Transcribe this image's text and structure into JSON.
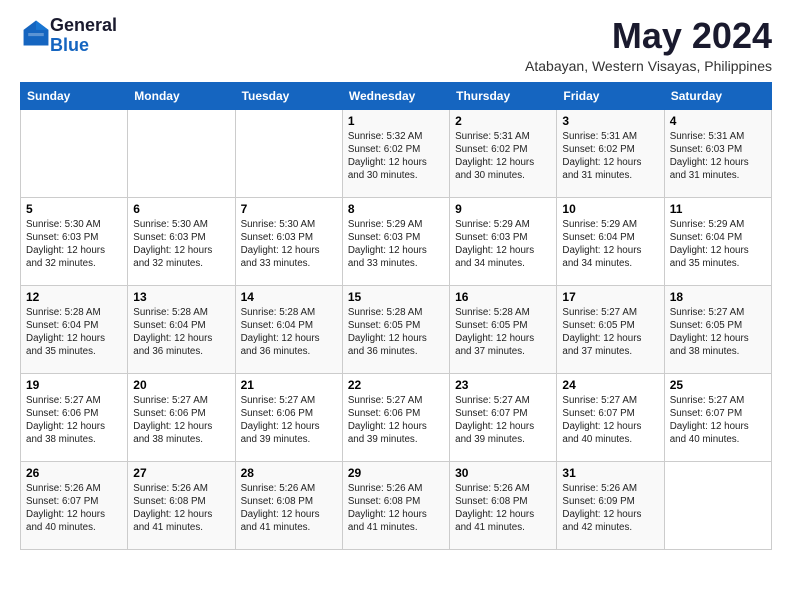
{
  "header": {
    "logo_general": "General",
    "logo_blue": "Blue",
    "month_year": "May 2024",
    "location": "Atabayan, Western Visayas, Philippines"
  },
  "weekdays": [
    "Sunday",
    "Monday",
    "Tuesday",
    "Wednesday",
    "Thursday",
    "Friday",
    "Saturday"
  ],
  "weeks": [
    [
      {
        "day": "",
        "info": ""
      },
      {
        "day": "",
        "info": ""
      },
      {
        "day": "",
        "info": ""
      },
      {
        "day": "1",
        "info": "Sunrise: 5:32 AM\nSunset: 6:02 PM\nDaylight: 12 hours and 30 minutes."
      },
      {
        "day": "2",
        "info": "Sunrise: 5:31 AM\nSunset: 6:02 PM\nDaylight: 12 hours and 30 minutes."
      },
      {
        "day": "3",
        "info": "Sunrise: 5:31 AM\nSunset: 6:02 PM\nDaylight: 12 hours and 31 minutes."
      },
      {
        "day": "4",
        "info": "Sunrise: 5:31 AM\nSunset: 6:03 PM\nDaylight: 12 hours and 31 minutes."
      }
    ],
    [
      {
        "day": "5",
        "info": "Sunrise: 5:30 AM\nSunset: 6:03 PM\nDaylight: 12 hours and 32 minutes."
      },
      {
        "day": "6",
        "info": "Sunrise: 5:30 AM\nSunset: 6:03 PM\nDaylight: 12 hours and 32 minutes."
      },
      {
        "day": "7",
        "info": "Sunrise: 5:30 AM\nSunset: 6:03 PM\nDaylight: 12 hours and 33 minutes."
      },
      {
        "day": "8",
        "info": "Sunrise: 5:29 AM\nSunset: 6:03 PM\nDaylight: 12 hours and 33 minutes."
      },
      {
        "day": "9",
        "info": "Sunrise: 5:29 AM\nSunset: 6:03 PM\nDaylight: 12 hours and 34 minutes."
      },
      {
        "day": "10",
        "info": "Sunrise: 5:29 AM\nSunset: 6:04 PM\nDaylight: 12 hours and 34 minutes."
      },
      {
        "day": "11",
        "info": "Sunrise: 5:29 AM\nSunset: 6:04 PM\nDaylight: 12 hours and 35 minutes."
      }
    ],
    [
      {
        "day": "12",
        "info": "Sunrise: 5:28 AM\nSunset: 6:04 PM\nDaylight: 12 hours and 35 minutes."
      },
      {
        "day": "13",
        "info": "Sunrise: 5:28 AM\nSunset: 6:04 PM\nDaylight: 12 hours and 36 minutes."
      },
      {
        "day": "14",
        "info": "Sunrise: 5:28 AM\nSunset: 6:04 PM\nDaylight: 12 hours and 36 minutes."
      },
      {
        "day": "15",
        "info": "Sunrise: 5:28 AM\nSunset: 6:05 PM\nDaylight: 12 hours and 36 minutes."
      },
      {
        "day": "16",
        "info": "Sunrise: 5:28 AM\nSunset: 6:05 PM\nDaylight: 12 hours and 37 minutes."
      },
      {
        "day": "17",
        "info": "Sunrise: 5:27 AM\nSunset: 6:05 PM\nDaylight: 12 hours and 37 minutes."
      },
      {
        "day": "18",
        "info": "Sunrise: 5:27 AM\nSunset: 6:05 PM\nDaylight: 12 hours and 38 minutes."
      }
    ],
    [
      {
        "day": "19",
        "info": "Sunrise: 5:27 AM\nSunset: 6:06 PM\nDaylight: 12 hours and 38 minutes."
      },
      {
        "day": "20",
        "info": "Sunrise: 5:27 AM\nSunset: 6:06 PM\nDaylight: 12 hours and 38 minutes."
      },
      {
        "day": "21",
        "info": "Sunrise: 5:27 AM\nSunset: 6:06 PM\nDaylight: 12 hours and 39 minutes."
      },
      {
        "day": "22",
        "info": "Sunrise: 5:27 AM\nSunset: 6:06 PM\nDaylight: 12 hours and 39 minutes."
      },
      {
        "day": "23",
        "info": "Sunrise: 5:27 AM\nSunset: 6:07 PM\nDaylight: 12 hours and 39 minutes."
      },
      {
        "day": "24",
        "info": "Sunrise: 5:27 AM\nSunset: 6:07 PM\nDaylight: 12 hours and 40 minutes."
      },
      {
        "day": "25",
        "info": "Sunrise: 5:27 AM\nSunset: 6:07 PM\nDaylight: 12 hours and 40 minutes."
      }
    ],
    [
      {
        "day": "26",
        "info": "Sunrise: 5:26 AM\nSunset: 6:07 PM\nDaylight: 12 hours and 40 minutes."
      },
      {
        "day": "27",
        "info": "Sunrise: 5:26 AM\nSunset: 6:08 PM\nDaylight: 12 hours and 41 minutes."
      },
      {
        "day": "28",
        "info": "Sunrise: 5:26 AM\nSunset: 6:08 PM\nDaylight: 12 hours and 41 minutes."
      },
      {
        "day": "29",
        "info": "Sunrise: 5:26 AM\nSunset: 6:08 PM\nDaylight: 12 hours and 41 minutes."
      },
      {
        "day": "30",
        "info": "Sunrise: 5:26 AM\nSunset: 6:08 PM\nDaylight: 12 hours and 41 minutes."
      },
      {
        "day": "31",
        "info": "Sunrise: 5:26 AM\nSunset: 6:09 PM\nDaylight: 12 hours and 42 minutes."
      },
      {
        "day": "",
        "info": ""
      }
    ]
  ]
}
